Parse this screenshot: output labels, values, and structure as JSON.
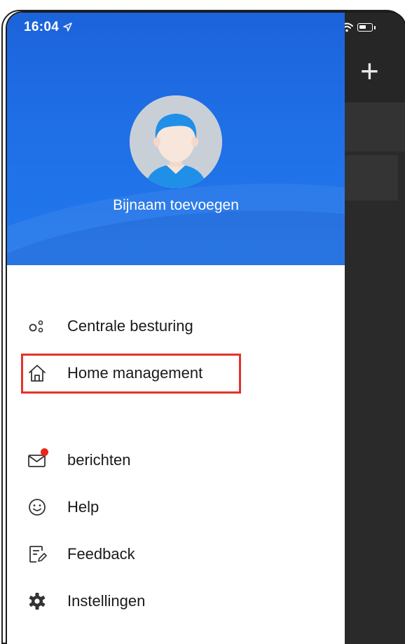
{
  "status_bar": {
    "time": "16:04"
  },
  "drawer": {
    "profile": {
      "nickname": "Bijnaam toevoegen"
    },
    "menu_group_1": [
      {
        "label": "Centrale besturing",
        "icon": "central-control-icon"
      },
      {
        "label": "Home management",
        "icon": "home-icon",
        "highlighted": true
      }
    ],
    "menu_group_2": [
      {
        "label": "berichten",
        "icon": "mail-icon",
        "has_unread_badge": true
      },
      {
        "label": "Help",
        "icon": "smiley-icon"
      },
      {
        "label": "Feedback",
        "icon": "feedback-icon"
      },
      {
        "label": "Instellingen",
        "icon": "gear-icon"
      }
    ]
  },
  "background_app": {
    "add_label": "+"
  },
  "colors": {
    "header_blue": "#1f6fe6",
    "highlight_red": "#e4332a",
    "badge_red": "#e8251c",
    "overlay_dark": "#2a2a2a"
  }
}
